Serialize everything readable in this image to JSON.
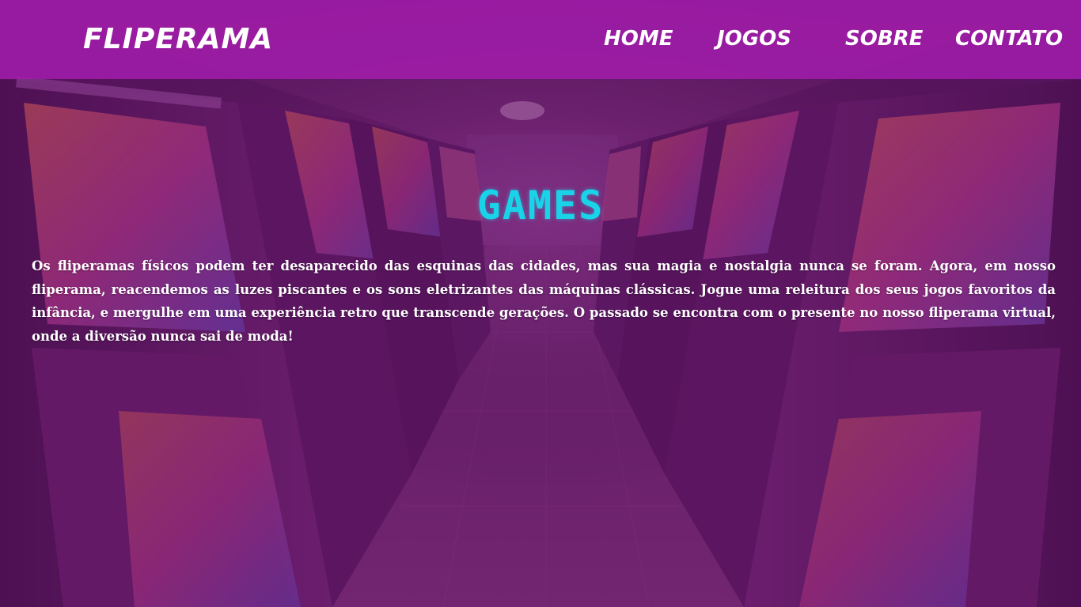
{
  "nav": {
    "brand": "FLIPERAMA",
    "links": [
      {
        "label": "HOME"
      },
      {
        "label": "JOGOS"
      },
      {
        "label": "SOBRE"
      },
      {
        "label": "CONTATO"
      }
    ]
  },
  "hero": {
    "title": "GAMES",
    "description": "Os fliperamas físicos podem ter desaparecido das esquinas das cidades, mas sua magia e nostalgia nunca se foram. Agora, em nosso fliperama, reacendemos as luzes piscantes e os sons eletrizantes das máquinas clássicas. Jogue uma releitura dos seus jogos favoritos da infância, e mergulhe em uma experiência retro que transcende gerações. O passado se encontra com o presente no nosso fliperama virtual, onde a diversão nunca sai de moda!"
  },
  "colors": {
    "navbar": "#a01caa",
    "title": "#19d3e8",
    "text": "#ffffff",
    "overlay": "#5f1464"
  },
  "background": {
    "description_icon": "arcade-corridor-image"
  }
}
